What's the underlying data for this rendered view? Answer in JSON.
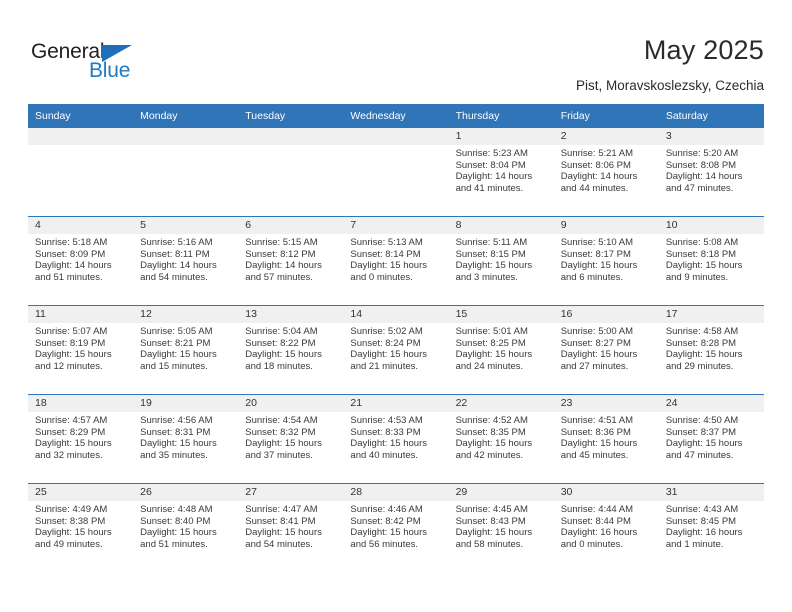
{
  "brand": {
    "name_part1": "General",
    "name_part2": "Blue",
    "triangle_color": "#1e6fb8",
    "blue_color": "#1e7bc4"
  },
  "header": {
    "title": "May 2025",
    "subtitle": "Pist, Moravskoslezsky, Czechia",
    "accent_color": "#3075b8",
    "band_color": "#f0f0f0"
  },
  "weekday_headers": [
    "Sunday",
    "Monday",
    "Tuesday",
    "Wednesday",
    "Thursday",
    "Friday",
    "Saturday"
  ],
  "weeks": [
    [
      {
        "day": "",
        "sunrise": "",
        "sunset": "",
        "daylight1": "",
        "daylight2": ""
      },
      {
        "day": "",
        "sunrise": "",
        "sunset": "",
        "daylight1": "",
        "daylight2": ""
      },
      {
        "day": "",
        "sunrise": "",
        "sunset": "",
        "daylight1": "",
        "daylight2": ""
      },
      {
        "day": "",
        "sunrise": "",
        "sunset": "",
        "daylight1": "",
        "daylight2": ""
      },
      {
        "day": "1",
        "sunrise": "Sunrise: 5:23 AM",
        "sunset": "Sunset: 8:04 PM",
        "daylight1": "Daylight: 14 hours",
        "daylight2": "and 41 minutes."
      },
      {
        "day": "2",
        "sunrise": "Sunrise: 5:21 AM",
        "sunset": "Sunset: 8:06 PM",
        "daylight1": "Daylight: 14 hours",
        "daylight2": "and 44 minutes."
      },
      {
        "day": "3",
        "sunrise": "Sunrise: 5:20 AM",
        "sunset": "Sunset: 8:08 PM",
        "daylight1": "Daylight: 14 hours",
        "daylight2": "and 47 minutes."
      }
    ],
    [
      {
        "day": "4",
        "sunrise": "Sunrise: 5:18 AM",
        "sunset": "Sunset: 8:09 PM",
        "daylight1": "Daylight: 14 hours",
        "daylight2": "and 51 minutes."
      },
      {
        "day": "5",
        "sunrise": "Sunrise: 5:16 AM",
        "sunset": "Sunset: 8:11 PM",
        "daylight1": "Daylight: 14 hours",
        "daylight2": "and 54 minutes."
      },
      {
        "day": "6",
        "sunrise": "Sunrise: 5:15 AM",
        "sunset": "Sunset: 8:12 PM",
        "daylight1": "Daylight: 14 hours",
        "daylight2": "and 57 minutes."
      },
      {
        "day": "7",
        "sunrise": "Sunrise: 5:13 AM",
        "sunset": "Sunset: 8:14 PM",
        "daylight1": "Daylight: 15 hours",
        "daylight2": "and 0 minutes."
      },
      {
        "day": "8",
        "sunrise": "Sunrise: 5:11 AM",
        "sunset": "Sunset: 8:15 PM",
        "daylight1": "Daylight: 15 hours",
        "daylight2": "and 3 minutes."
      },
      {
        "day": "9",
        "sunrise": "Sunrise: 5:10 AM",
        "sunset": "Sunset: 8:17 PM",
        "daylight1": "Daylight: 15 hours",
        "daylight2": "and 6 minutes."
      },
      {
        "day": "10",
        "sunrise": "Sunrise: 5:08 AM",
        "sunset": "Sunset: 8:18 PM",
        "daylight1": "Daylight: 15 hours",
        "daylight2": "and 9 minutes."
      }
    ],
    [
      {
        "day": "11",
        "sunrise": "Sunrise: 5:07 AM",
        "sunset": "Sunset: 8:19 PM",
        "daylight1": "Daylight: 15 hours",
        "daylight2": "and 12 minutes."
      },
      {
        "day": "12",
        "sunrise": "Sunrise: 5:05 AM",
        "sunset": "Sunset: 8:21 PM",
        "daylight1": "Daylight: 15 hours",
        "daylight2": "and 15 minutes."
      },
      {
        "day": "13",
        "sunrise": "Sunrise: 5:04 AM",
        "sunset": "Sunset: 8:22 PM",
        "daylight1": "Daylight: 15 hours",
        "daylight2": "and 18 minutes."
      },
      {
        "day": "14",
        "sunrise": "Sunrise: 5:02 AM",
        "sunset": "Sunset: 8:24 PM",
        "daylight1": "Daylight: 15 hours",
        "daylight2": "and 21 minutes."
      },
      {
        "day": "15",
        "sunrise": "Sunrise: 5:01 AM",
        "sunset": "Sunset: 8:25 PM",
        "daylight1": "Daylight: 15 hours",
        "daylight2": "and 24 minutes."
      },
      {
        "day": "16",
        "sunrise": "Sunrise: 5:00 AM",
        "sunset": "Sunset: 8:27 PM",
        "daylight1": "Daylight: 15 hours",
        "daylight2": "and 27 minutes."
      },
      {
        "day": "17",
        "sunrise": "Sunrise: 4:58 AM",
        "sunset": "Sunset: 8:28 PM",
        "daylight1": "Daylight: 15 hours",
        "daylight2": "and 29 minutes."
      }
    ],
    [
      {
        "day": "18",
        "sunrise": "Sunrise: 4:57 AM",
        "sunset": "Sunset: 8:29 PM",
        "daylight1": "Daylight: 15 hours",
        "daylight2": "and 32 minutes."
      },
      {
        "day": "19",
        "sunrise": "Sunrise: 4:56 AM",
        "sunset": "Sunset: 8:31 PM",
        "daylight1": "Daylight: 15 hours",
        "daylight2": "and 35 minutes."
      },
      {
        "day": "20",
        "sunrise": "Sunrise: 4:54 AM",
        "sunset": "Sunset: 8:32 PM",
        "daylight1": "Daylight: 15 hours",
        "daylight2": "and 37 minutes."
      },
      {
        "day": "21",
        "sunrise": "Sunrise: 4:53 AM",
        "sunset": "Sunset: 8:33 PM",
        "daylight1": "Daylight: 15 hours",
        "daylight2": "and 40 minutes."
      },
      {
        "day": "22",
        "sunrise": "Sunrise: 4:52 AM",
        "sunset": "Sunset: 8:35 PM",
        "daylight1": "Daylight: 15 hours",
        "daylight2": "and 42 minutes."
      },
      {
        "day": "23",
        "sunrise": "Sunrise: 4:51 AM",
        "sunset": "Sunset: 8:36 PM",
        "daylight1": "Daylight: 15 hours",
        "daylight2": "and 45 minutes."
      },
      {
        "day": "24",
        "sunrise": "Sunrise: 4:50 AM",
        "sunset": "Sunset: 8:37 PM",
        "daylight1": "Daylight: 15 hours",
        "daylight2": "and 47 minutes."
      }
    ],
    [
      {
        "day": "25",
        "sunrise": "Sunrise: 4:49 AM",
        "sunset": "Sunset: 8:38 PM",
        "daylight1": "Daylight: 15 hours",
        "daylight2": "and 49 minutes."
      },
      {
        "day": "26",
        "sunrise": "Sunrise: 4:48 AM",
        "sunset": "Sunset: 8:40 PM",
        "daylight1": "Daylight: 15 hours",
        "daylight2": "and 51 minutes."
      },
      {
        "day": "27",
        "sunrise": "Sunrise: 4:47 AM",
        "sunset": "Sunset: 8:41 PM",
        "daylight1": "Daylight: 15 hours",
        "daylight2": "and 54 minutes."
      },
      {
        "day": "28",
        "sunrise": "Sunrise: 4:46 AM",
        "sunset": "Sunset: 8:42 PM",
        "daylight1": "Daylight: 15 hours",
        "daylight2": "and 56 minutes."
      },
      {
        "day": "29",
        "sunrise": "Sunrise: 4:45 AM",
        "sunset": "Sunset: 8:43 PM",
        "daylight1": "Daylight: 15 hours",
        "daylight2": "and 58 minutes."
      },
      {
        "day": "30",
        "sunrise": "Sunrise: 4:44 AM",
        "sunset": "Sunset: 8:44 PM",
        "daylight1": "Daylight: 16 hours",
        "daylight2": "and 0 minutes."
      },
      {
        "day": "31",
        "sunrise": "Sunrise: 4:43 AM",
        "sunset": "Sunset: 8:45 PM",
        "daylight1": "Daylight: 16 hours",
        "daylight2": "and 1 minute."
      }
    ]
  ]
}
